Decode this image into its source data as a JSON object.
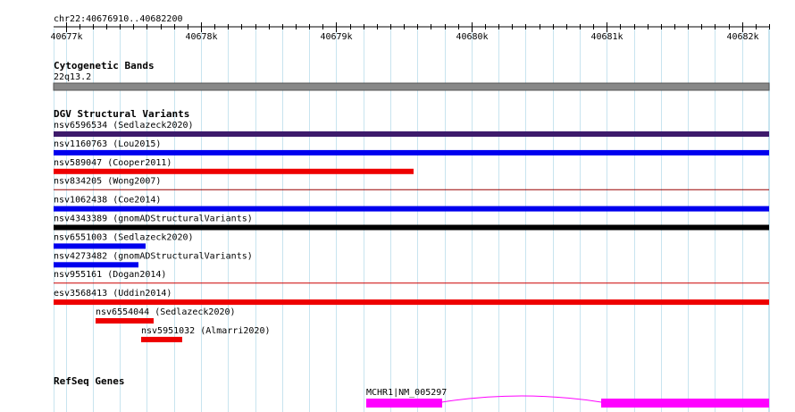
{
  "ruler": {
    "location": "chr22:40676910..40682200",
    "start": 40676910,
    "end": 40682200,
    "ticks_major": [
      {
        "pos": 40677000,
        "label": "40677k"
      },
      {
        "pos": 40678000,
        "label": "40678k"
      },
      {
        "pos": 40679000,
        "label": "40679k"
      },
      {
        "pos": 40680000,
        "label": "40680k"
      },
      {
        "pos": 40681000,
        "label": "40681k"
      },
      {
        "pos": 40682000,
        "label": "40682k"
      }
    ],
    "minor_step": 100,
    "grid_step": 200
  },
  "tracks": {
    "cytoband": {
      "title": "Cytogenetic Bands",
      "band_label": "22q13.2",
      "band_color": "#888888"
    },
    "dgv": {
      "title": "DGV Structural Variants",
      "features": [
        {
          "label": "nsv6596534 (Sedlazeck2020)",
          "start": 40676910,
          "end": 40682200,
          "color": "#3d1a6b",
          "style": "bar"
        },
        {
          "label": "nsv1160763 (Lou2015)",
          "start": 40676910,
          "end": 40682200,
          "color": "#0000ee",
          "style": "bar"
        },
        {
          "label": "nsv589047 (Cooper2011)",
          "start": 40676910,
          "end": 40679570,
          "color": "#ee0000",
          "style": "bar"
        },
        {
          "label": "nsv834205 (Wong2007)",
          "start": 40676910,
          "end": 40682200,
          "color": "#990000",
          "style": "line"
        },
        {
          "label": "nsv1062438 (Coe2014)",
          "start": 40676910,
          "end": 40682200,
          "color": "#0000ee",
          "style": "bar"
        },
        {
          "label": "nsv4343389 (gnomADStructuralVariants)",
          "start": 40676910,
          "end": 40682200,
          "color": "#000000",
          "style": "bar"
        },
        {
          "label": "nsv6551003 (Sedlazeck2020)",
          "start": 40676910,
          "end": 40677590,
          "color": "#0000ee",
          "style": "bar"
        },
        {
          "label": "nsv4273482 (gnomADStructuralVariants)",
          "start": 40676910,
          "end": 40677540,
          "color": "#0000ee",
          "style": "bar"
        },
        {
          "label": "nsv955161 (Dogan2014)",
          "start": 40676910,
          "end": 40682200,
          "color": "#cc0000",
          "style": "line"
        },
        {
          "label": "esv3568413 (Uddin2014)",
          "start": 40676910,
          "end": 40682200,
          "color": "#ee0000",
          "style": "bar"
        },
        {
          "label": "nsv6554044 (Sedlazeck2020)",
          "start": 40677220,
          "end": 40677650,
          "color": "#ee0000",
          "style": "bar"
        },
        {
          "label": "nsv5951032 (Almarri2020)",
          "start": 40677560,
          "end": 40677860,
          "color": "#ee0000",
          "style": "bar"
        }
      ]
    },
    "refseq": {
      "title": "RefSeq Genes",
      "gene_label": "MCHR1|NM_005297",
      "color": "#ff00ff",
      "exons": [
        {
          "start": 40679220,
          "end": 40679780
        },
        {
          "start": 40680960,
          "end": 40682200
        }
      ],
      "intron": {
        "start": 40679780,
        "end": 40680960
      }
    }
  }
}
